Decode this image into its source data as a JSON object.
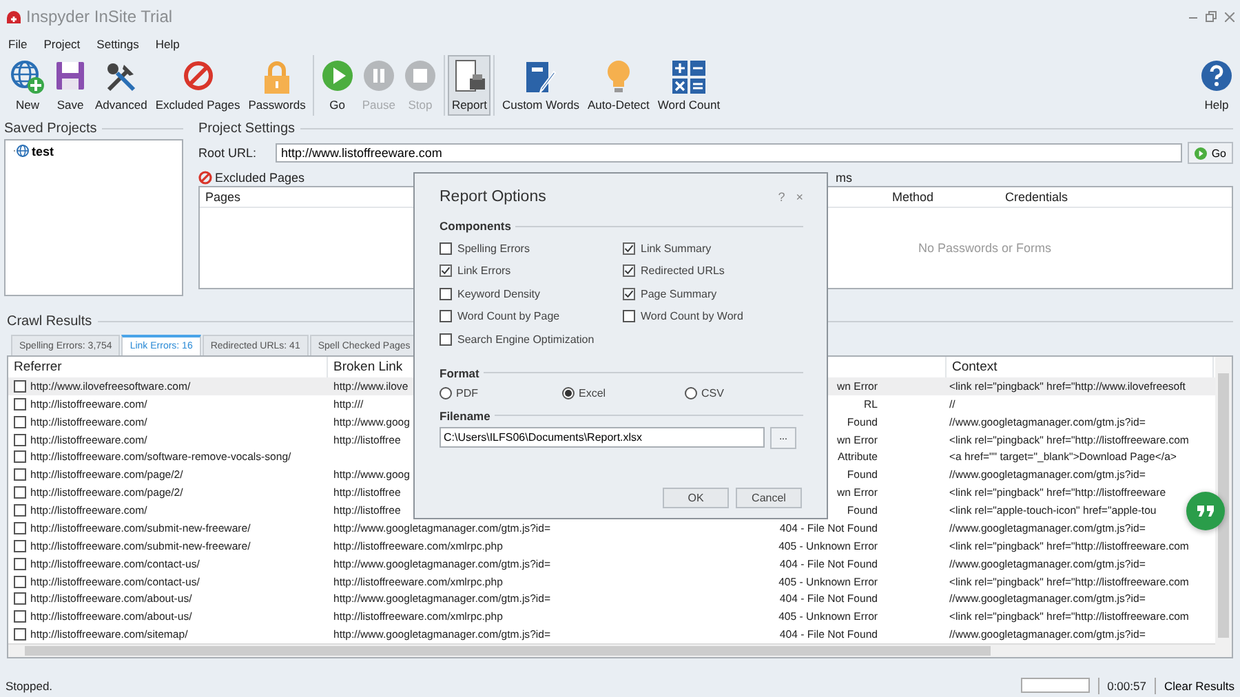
{
  "window": {
    "title": "Inspyder InSite Trial"
  },
  "menu": [
    "File",
    "Project",
    "Settings",
    "Help"
  ],
  "toolbar": {
    "groups": [
      [
        {
          "label": "New",
          "disabled": false,
          "pressed": false
        },
        {
          "label": "Save",
          "disabled": false,
          "pressed": false
        },
        {
          "label": "Advanced",
          "disabled": false,
          "pressed": false
        },
        {
          "label": "Excluded Pages",
          "disabled": false,
          "pressed": false
        },
        {
          "label": "Passwords",
          "disabled": false,
          "pressed": false
        }
      ],
      [
        {
          "label": "Go",
          "disabled": false,
          "pressed": false
        },
        {
          "label": "Pause",
          "disabled": true,
          "pressed": false
        },
        {
          "label": "Stop",
          "disabled": true,
          "pressed": false
        }
      ],
      [
        {
          "label": "Report",
          "disabled": false,
          "pressed": true
        }
      ],
      [
        {
          "label": "Custom Words",
          "disabled": false,
          "pressed": false
        },
        {
          "label": "Auto-Detect",
          "disabled": false,
          "pressed": false
        },
        {
          "label": "Word Count",
          "disabled": false,
          "pressed": false
        }
      ]
    ],
    "help": {
      "label": "Help"
    }
  },
  "saved_projects": {
    "title": "Saved Projects",
    "items": [
      {
        "label": "test",
        "selected": false
      }
    ]
  },
  "project_settings": {
    "title": "Project Settings",
    "root_url_label": "Root URL:",
    "root_url": "http://www.listoffreeware.com",
    "go_button": "Go",
    "excluded": {
      "label": "Excluded Pages",
      "columns": [
        "Pages"
      ]
    },
    "passwords": {
      "label": "ms",
      "columns": [
        "Method",
        "Credentials"
      ],
      "empty_text": "No Passwords or Forms"
    }
  },
  "crawl_results": {
    "title": "Crawl Results",
    "tabs": [
      {
        "label": "Spelling Errors: 3,754",
        "selected": false
      },
      {
        "label": "Link Errors: 16",
        "selected": true
      },
      {
        "label": "Redirected URLs: 41",
        "selected": false
      },
      {
        "label": "Spell Checked Pages",
        "selected": false
      }
    ],
    "columns": [
      "Referrer",
      "Broken Link",
      "Context"
    ],
    "rows": [
      {
        "checked": false,
        "selected": true,
        "referrer": "http://www.ilovefreesoftware.com/",
        "broken_link": "http://www.ilove",
        "status": "wn Error",
        "context": "<link rel=\"pingback\" href=\"http://www.ilovefreesoft"
      },
      {
        "checked": false,
        "selected": false,
        "referrer": "http://listoffreeware.com/",
        "broken_link": "http:///",
        "status": "RL",
        "context": "//"
      },
      {
        "checked": false,
        "selected": false,
        "referrer": "http://listoffreeware.com/",
        "broken_link": "http://www.goog",
        "status": "Found",
        "context": "//www.googletagmanager.com/gtm.js?id="
      },
      {
        "checked": false,
        "selected": false,
        "referrer": "http://listoffreeware.com/",
        "broken_link": "http://listoffree",
        "status": "wn Error",
        "context": "<link rel=\"pingback\" href=\"http://listoffreeware.com"
      },
      {
        "checked": false,
        "selected": false,
        "referrer": "http://listoffreeware.com/software-remove-vocals-song/",
        "broken_link": "",
        "status": "Attribute",
        "context": "<a href=\"\" target=\"_blank\">Download Page</a>"
      },
      {
        "checked": false,
        "selected": false,
        "referrer": "http://listoffreeware.com/page/2/",
        "broken_link": "http://www.goog",
        "status": "Found",
        "context": "//www.googletagmanager.com/gtm.js?id="
      },
      {
        "checked": false,
        "selected": false,
        "referrer": "http://listoffreeware.com/page/2/",
        "broken_link": "http://listoffree",
        "status": "wn Error",
        "context": "<link rel=\"pingback\" href=\"http://listoffreeware"
      },
      {
        "checked": false,
        "selected": false,
        "referrer": "http://listoffreeware.com/",
        "broken_link": "http://listoffree",
        "status": "Found",
        "context": "<link rel=\"apple-touch-icon\" href=\"apple-tou"
      },
      {
        "checked": false,
        "selected": false,
        "referrer": "http://listoffreeware.com/submit-new-freeware/",
        "broken_link": "http://www.googletagmanager.com/gtm.js?id=",
        "status": "404 - File Not Found",
        "context": "//www.googletagmanager.com/gtm.js?id="
      },
      {
        "checked": false,
        "selected": false,
        "referrer": "http://listoffreeware.com/submit-new-freeware/",
        "broken_link": "http://listoffreeware.com/xmlrpc.php",
        "status": "405 - Unknown Error",
        "context": "<link rel=\"pingback\" href=\"http://listoffreeware.com"
      },
      {
        "checked": false,
        "selected": false,
        "referrer": "http://listoffreeware.com/contact-us/",
        "broken_link": "http://www.googletagmanager.com/gtm.js?id=",
        "status": "404 - File Not Found",
        "context": "//www.googletagmanager.com/gtm.js?id="
      },
      {
        "checked": false,
        "selected": false,
        "referrer": "http://listoffreeware.com/contact-us/",
        "broken_link": "http://listoffreeware.com/xmlrpc.php",
        "status": "405 - Unknown Error",
        "context": "<link rel=\"pingback\" href=\"http://listoffreeware.com"
      },
      {
        "checked": false,
        "selected": false,
        "referrer": "http://listoffreeware.com/about-us/",
        "broken_link": "http://www.googletagmanager.com/gtm.js?id=",
        "status": "404 - File Not Found",
        "context": "//www.googletagmanager.com/gtm.js?id="
      },
      {
        "checked": false,
        "selected": false,
        "referrer": "http://listoffreeware.com/about-us/",
        "broken_link": "http://listoffreeware.com/xmlrpc.php",
        "status": "405 - Unknown Error",
        "context": "<link rel=\"pingback\" href=\"http://listoffreeware.com"
      },
      {
        "checked": false,
        "selected": false,
        "referrer": "http://listoffreeware.com/sitemap/",
        "broken_link": "http://www.googletagmanager.com/gtm.js?id=",
        "status": "404 - File Not Found",
        "context": "//www.googletagmanager.com/gtm.js?id="
      }
    ]
  },
  "status_bar": {
    "text": "Stopped.",
    "level": 0,
    "elapsed": "0:00:57",
    "clear_button": "Clear Results"
  },
  "dialog": {
    "title": "Report Options",
    "help": "?",
    "close": "×",
    "components_title": "Components",
    "components_left": [
      {
        "label": "Spelling Errors",
        "checked": false
      },
      {
        "label": "Link Errors",
        "checked": true
      },
      {
        "label": "Keyword Density",
        "checked": false
      },
      {
        "label": "Word Count by Page",
        "checked": false
      },
      {
        "label": "Search Engine Optimization",
        "checked": false
      }
    ],
    "components_right": [
      {
        "label": "Link Summary",
        "checked": true
      },
      {
        "label": "Redirected URLs",
        "checked": true
      },
      {
        "label": "Page Summary",
        "checked": true
      },
      {
        "label": "Word Count by Word",
        "checked": false
      }
    ],
    "format_title": "Format",
    "formats": [
      {
        "label": "PDF",
        "selected": false
      },
      {
        "label": "Excel",
        "selected": true
      },
      {
        "label": "CSV",
        "selected": false
      }
    ],
    "filename_title": "Filename",
    "filename": "C:\\Users\\ILFS06\\Documents\\Report.xlsx",
    "browse_button": "...",
    "buttons": [
      "OK",
      "Cancel"
    ]
  }
}
